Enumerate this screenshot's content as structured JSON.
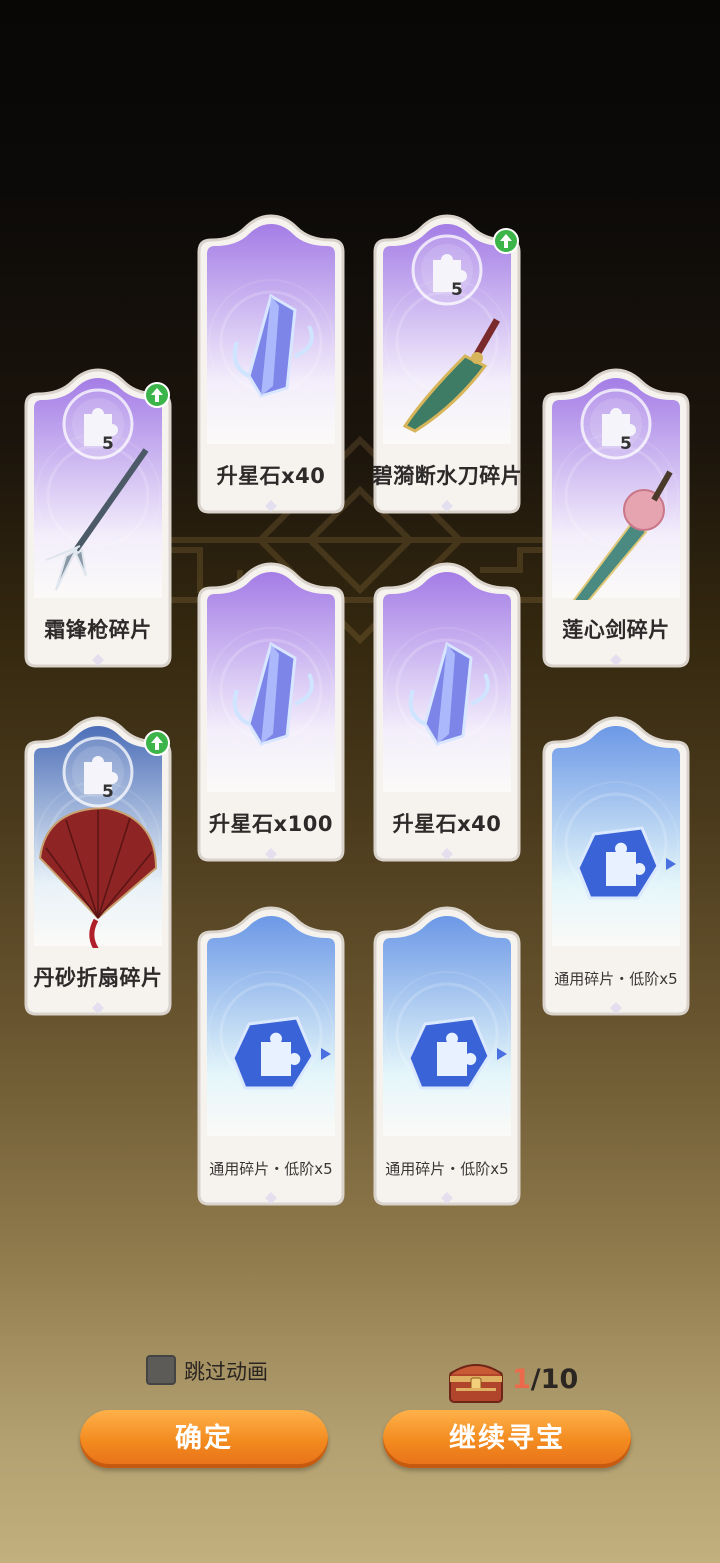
{
  "cards": [
    {
      "id": "c1",
      "label": "升星石x40",
      "kind": "stone",
      "badge": "",
      "up": false
    },
    {
      "id": "c2",
      "label": "碧漪断水刀碎片",
      "kind": "blade",
      "badge": "5",
      "up": true
    },
    {
      "id": "c3",
      "label": "霜锋枪碎片",
      "kind": "spear",
      "badge": "5",
      "up": true
    },
    {
      "id": "c4",
      "label": "莲心剑碎片",
      "kind": "sword",
      "badge": "5",
      "up": false
    },
    {
      "id": "c5",
      "label": "升星石x100",
      "kind": "stone",
      "badge": "",
      "up": false
    },
    {
      "id": "c6",
      "label": "升星石x40",
      "kind": "stone",
      "badge": "",
      "up": false
    },
    {
      "id": "c7",
      "label": "丹砂折扇碎片",
      "kind": "fan",
      "badge": "5",
      "up": true
    },
    {
      "id": "c8",
      "label": "通用碎片・低阶x5",
      "kind": "shard",
      "badge": "",
      "up": false
    },
    {
      "id": "c9",
      "label": "通用碎片・低阶x5",
      "kind": "shard",
      "badge": "",
      "up": false
    },
    {
      "id": "c10",
      "label": "通用碎片・低阶x5",
      "kind": "shard",
      "badge": "",
      "up": false
    }
  ],
  "skip_animation": {
    "label": "跳过动画",
    "checked": false
  },
  "counter": {
    "current": "1",
    "total": "/10"
  },
  "buttons": {
    "confirm": "确定",
    "continue": "继续寻宝"
  },
  "colors": {
    "purple_top": "#a57ee8",
    "purple_bottom": "#f1eafb",
    "blue_top": "#6d9be8",
    "blue_bottom": "#e6f5fb",
    "fan_top": "#5578c4",
    "accent": "#f28a1e",
    "green": "#3bb54a"
  }
}
